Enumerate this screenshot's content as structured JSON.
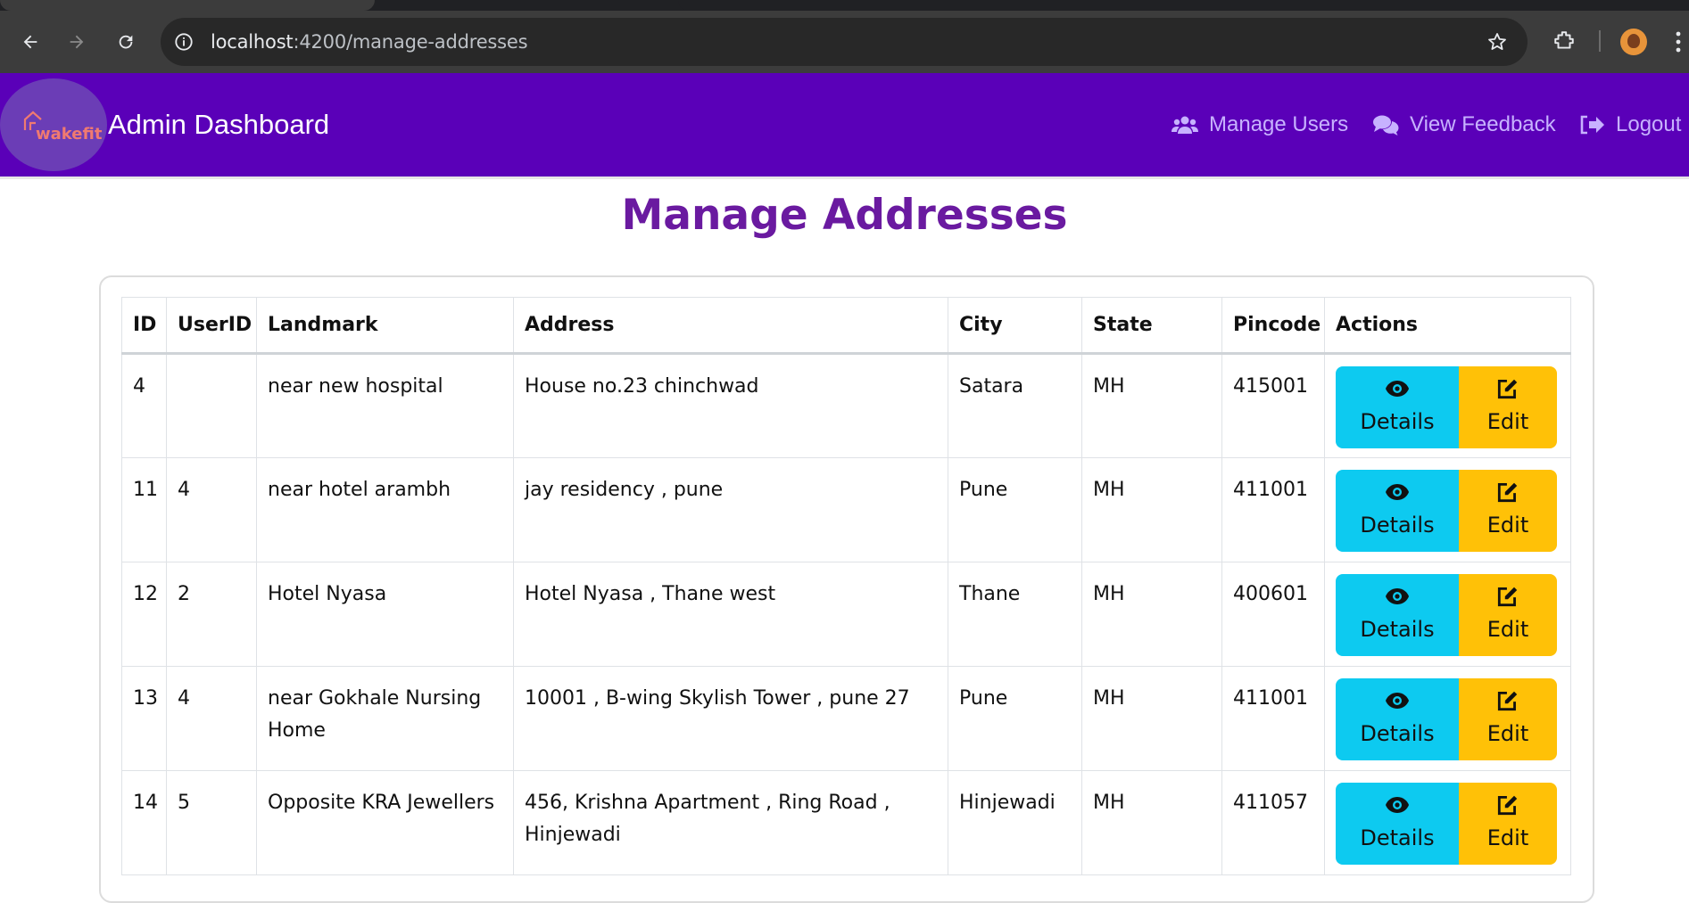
{
  "browser": {
    "url_host": "localhost",
    "url_path": ":4200/manage-addresses"
  },
  "navbar": {
    "logo_text": "wakefit",
    "title": "Admin Dashboard",
    "links": [
      {
        "label": "Manage Users",
        "icon": "users-icon"
      },
      {
        "label": "View Feedback",
        "icon": "comments-icon"
      },
      {
        "label": "Logout",
        "icon": "logout-icon"
      }
    ]
  },
  "page": {
    "title": "Manage Addresses"
  },
  "table": {
    "headers": [
      "ID",
      "UserID",
      "Landmark",
      "Address",
      "City",
      "State",
      "Pincode",
      "Actions"
    ],
    "rows": [
      {
        "id": "4",
        "user_id": "",
        "landmark": "near new hospital",
        "address": "House no.23 chinchwad",
        "city": "Satara",
        "state": "MH",
        "pincode": "415001"
      },
      {
        "id": "11",
        "user_id": "4",
        "landmark": "near hotel arambh",
        "address": "jay residency , pune",
        "city": "Pune",
        "state": "MH",
        "pincode": "411001"
      },
      {
        "id": "12",
        "user_id": "2",
        "landmark": "Hotel Nyasa",
        "address": "Hotel Nyasa , Thane west",
        "city": "Thane",
        "state": "MH",
        "pincode": "400601"
      },
      {
        "id": "13",
        "user_id": "4",
        "landmark": "near Gokhale Nursing Home",
        "address": "10001 , B-wing Skylish Tower , pune 27",
        "city": "Pune",
        "state": "MH",
        "pincode": "411001"
      },
      {
        "id": "14",
        "user_id": "5",
        "landmark": "Opposite KRA Jewellers",
        "address": "456, Krishna Apartment , Ring Road , Hinjewadi",
        "city": "Hinjewadi",
        "state": "MH",
        "pincode": "411057"
      }
    ],
    "action_details_label": "Details",
    "action_edit_label": "Edit"
  },
  "colors": {
    "navbar": "#5a00b8",
    "title": "#6a1aa0",
    "details_button": "#0dcaf0",
    "edit_button": "#ffc107"
  }
}
